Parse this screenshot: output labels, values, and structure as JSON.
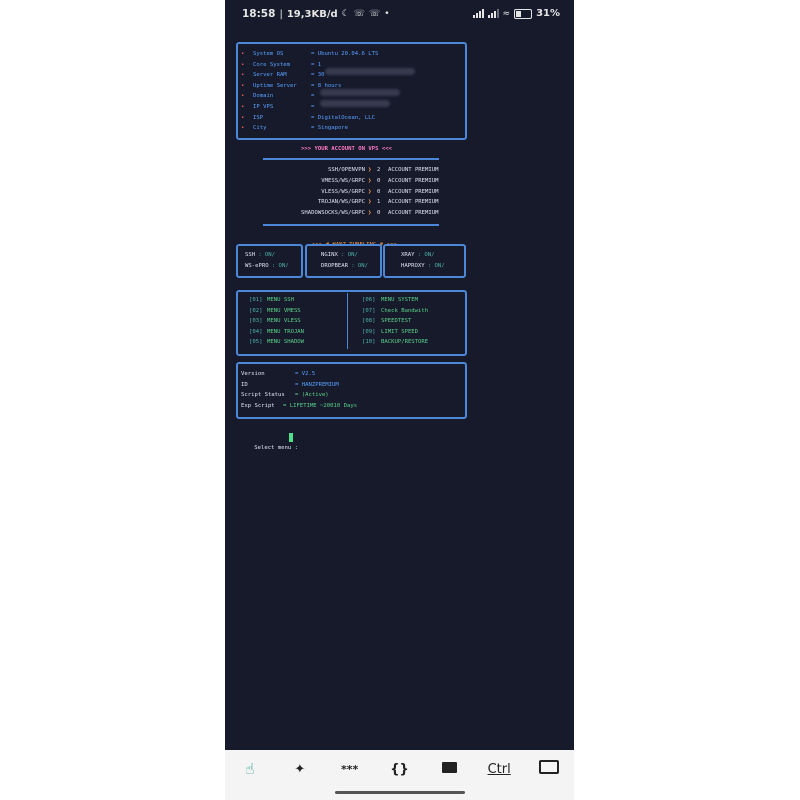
{
  "status_bar": {
    "time": "18:58",
    "speed": "19,3KB/d",
    "battery": "31%",
    "icons": [
      "moon-icon",
      "whatsapp-icon",
      "whatsapp-icon",
      "dot-icon",
      "signal-icon",
      "signal-icon",
      "wifi-icon",
      "battery-icon"
    ]
  },
  "system_info": {
    "rows": [
      {
        "label": "System OS",
        "value": "= Ubuntu 20.04.6 LTS"
      },
      {
        "label": "Core System",
        "value": "= 1"
      },
      {
        "label": "Server RAM",
        "value": "= 30"
      },
      {
        "label": "Uptime Server",
        "value": "= 8 hours"
      },
      {
        "label": "Domain",
        "value": "="
      },
      {
        "label": "IP VPS",
        "value": "="
      },
      {
        "label": "ISP",
        "value": "= DigitalOcean, LLC"
      },
      {
        "label": "City",
        "value": "= Singapore"
      }
    ]
  },
  "account": {
    "header": ">>> YOUR ACCOUNT ON VPS <<<",
    "rows": [
      {
        "proto": "SSH/OPENVPN",
        "count": "2",
        "label": "ACCOUNT PREMIUM"
      },
      {
        "proto": "VMESS/WS/GRPC",
        "count": "0",
        "label": "ACCOUNT PREMIUM"
      },
      {
        "proto": "VLESS/WS/GRPC",
        "count": "0",
        "label": "ACCOUNT PREMIUM"
      },
      {
        "proto": "TROJAN/WS/GRPC",
        "count": "1",
        "label": "ACCOUNT PREMIUM"
      },
      {
        "proto": "SHADOWSOCKS/WS/GRPC",
        "count": "0",
        "label": "ACCOUNT PREMIUM"
      }
    ]
  },
  "tunneling": {
    "header": ">>> # HANZ TUNELING # <<<",
    "services": [
      {
        "name": "SSH",
        "status": ": ON/"
      },
      {
        "name": "NGINX",
        "status": ": ON/"
      },
      {
        "name": "XRAY",
        "status": ": ON/"
      },
      {
        "name": "WS-ePRO",
        "status": ": ON/"
      },
      {
        "name": "DROPBEAR",
        "status": ": ON/"
      },
      {
        "name": "HAPROXY",
        "status": ": ON/"
      }
    ]
  },
  "menu": {
    "left": [
      {
        "code": "[01]",
        "label": "MENU SSH"
      },
      {
        "code": "[02]",
        "label": "MENU VMESS"
      },
      {
        "code": "[03]",
        "label": "MENU VLESS"
      },
      {
        "code": "[04]",
        "label": "MENU TROJAN"
      },
      {
        "code": "[05]",
        "label": "MENU SHADOW"
      }
    ],
    "right": [
      {
        "code": "[06]",
        "label": "MENU SYSTEM"
      },
      {
        "code": "[07]",
        "label": "Check Bandwith"
      },
      {
        "code": "[08]",
        "label": "SPEEDTEST"
      },
      {
        "code": "[09]",
        "label": "LIMIT SPEED"
      },
      {
        "code": "[10]",
        "label": "BACKUP/RESTORE"
      }
    ]
  },
  "script_info": {
    "rows": [
      {
        "label": "Version       ",
        "value": "= V2.5"
      },
      {
        "label": "ID            ",
        "value": "= HANZPREMIUM"
      },
      {
        "label": "Script Status ",
        "value": "= (Active)"
      },
      {
        "label": "Exp Script ",
        "value": "= LIFETIME ~20010 Days"
      }
    ]
  },
  "prompt": {
    "text": "Select menu : "
  },
  "toolbar": {
    "keys": [
      {
        "name": "touch-icon",
        "label": ""
      },
      {
        "name": "magic-wand-icon",
        "label": ""
      },
      {
        "name": "ellipsis-key",
        "label": "***"
      },
      {
        "name": "braces-key",
        "label": "{}"
      },
      {
        "name": "folder-icon",
        "label": ""
      },
      {
        "name": "ctrl-key",
        "label": "Ctrl"
      },
      {
        "name": "keyboard-icon",
        "label": ""
      }
    ]
  }
}
